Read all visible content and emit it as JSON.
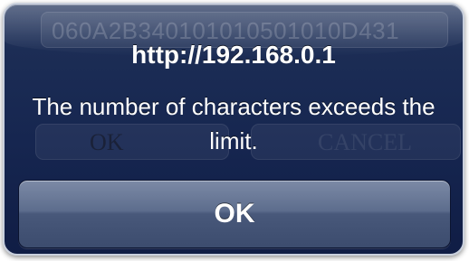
{
  "background": {
    "field_text": "060A2B340101010501010D431",
    "ok_label": "OK",
    "cancel_label": "CANCEL"
  },
  "alert": {
    "title": "http://192.168.0.1",
    "message": "The number of characters exceeds the limit.",
    "ok_button_label": "OK"
  },
  "colors": {
    "alert_background": "#162650",
    "button_face": "#5d6d8d",
    "text": "#ffffff"
  }
}
